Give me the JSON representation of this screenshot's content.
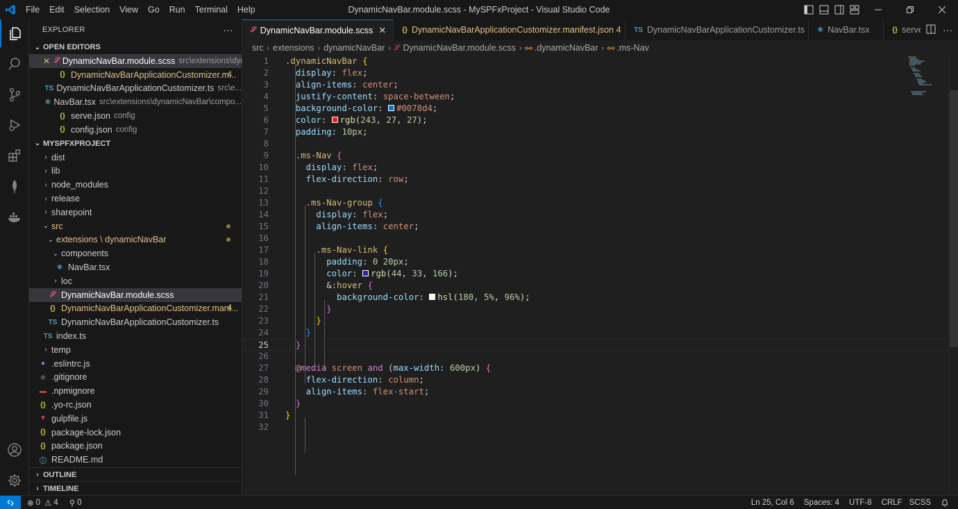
{
  "title_bar": {
    "menu": [
      "File",
      "Edit",
      "Selection",
      "View",
      "Go",
      "Run",
      "Terminal",
      "Help"
    ],
    "window_title": "DynamicNavBar.module.scss - MySPFxProject - Visual Studio Code"
  },
  "sidebar": {
    "header": "EXPLORER",
    "open_editors_label": "OPEN EDITORS",
    "open_editors": [
      {
        "name": "DynamicNavBar.module.scss",
        "desc": "src\\extensions\\dyn...",
        "icon": "scss-icon",
        "badge": ""
      },
      {
        "name": "DynamicNavBarApplicationCustomizer.m...",
        "desc": "",
        "icon": "json-icon",
        "badge": "4"
      },
      {
        "name": "DynamicNavBarApplicationCustomizer.ts",
        "desc": "src\\e...",
        "icon": "ts-icon",
        "badge": ""
      },
      {
        "name": "NavBar.tsx",
        "desc": "src\\extensions\\dynamicNavBar\\compo...",
        "icon": "react-icon",
        "badge": ""
      },
      {
        "name": "serve.json",
        "desc": "config",
        "icon": "json-icon",
        "badge": ""
      },
      {
        "name": "config.json",
        "desc": "config",
        "icon": "json-icon",
        "badge": ""
      }
    ],
    "project_label": "MYSPFXPROJECT",
    "tree": [
      {
        "name": "dist",
        "type": "folder"
      },
      {
        "name": "lib",
        "type": "folder"
      },
      {
        "name": "node_modules",
        "type": "folder"
      },
      {
        "name": "release",
        "type": "folder"
      },
      {
        "name": "sharepoint",
        "type": "folder"
      },
      {
        "name": "src",
        "type": "folder-open"
      },
      {
        "name": "extensions \\ dynamicNavBar",
        "type": "folder-open"
      },
      {
        "name": "components",
        "type": "folder-open"
      },
      {
        "name": "NavBar.tsx",
        "type": "file"
      },
      {
        "name": "loc",
        "type": "folder"
      },
      {
        "name": "DynamicNavBar.module.scss",
        "type": "file"
      },
      {
        "name": "DynamicNavBarApplicationCustomizer.mani...",
        "type": "file",
        "badge": "4"
      },
      {
        "name": "DynamicNavBarApplicationCustomizer.ts",
        "type": "file"
      },
      {
        "name": "index.ts",
        "type": "file"
      },
      {
        "name": "temp",
        "type": "folder"
      },
      {
        "name": ".eslintrc.js",
        "type": "file"
      },
      {
        "name": ".gitignore",
        "type": "file"
      },
      {
        "name": ".npmignore",
        "type": "file"
      },
      {
        "name": ".yo-rc.json",
        "type": "file"
      },
      {
        "name": "gulpfile.js",
        "type": "file"
      },
      {
        "name": "package-lock.json",
        "type": "file"
      },
      {
        "name": "package.json",
        "type": "file"
      },
      {
        "name": "README.md",
        "type": "file"
      }
    ],
    "outline_label": "OUTLINE",
    "timeline_label": "TIMELINE"
  },
  "tabs": [
    {
      "label": "DynamicNavBar.module.scss",
      "icon": "scss-icon",
      "active": true
    },
    {
      "label": "DynamicNavBarApplicationCustomizer.manifest.json 4",
      "icon": "json-icon",
      "active": false
    },
    {
      "label": "DynamicNavBarApplicationCustomizer.ts",
      "icon": "ts-icon",
      "active": false
    },
    {
      "label": "NavBar.tsx",
      "icon": "react-icon",
      "active": false
    },
    {
      "label": "serve.js",
      "icon": "json-icon",
      "active": false
    }
  ],
  "breadcrumbs": [
    "src",
    "extensions",
    "dynamicNavBar",
    "DynamicNavBar.module.scss",
    ".dynamicNavBar",
    ".ms-Nav"
  ],
  "code_lines": [
    ".dynamicNavBar {",
    "  display: flex;",
    "  align-items: center;",
    "  justify-content: space-between;",
    "  background-color: #0078d4;",
    "  color: rgb(243, 27, 27);",
    "  padding: 10px;",
    "",
    "  .ms-Nav {",
    "    display: flex;",
    "    flex-direction: row;",
    "",
    "    .ms-Nav-group {",
    "      display: flex;",
    "      align-items: center;",
    "",
    "      .ms-Nav-link {",
    "        padding: 0 20px;",
    "        color: rgb(44, 33, 166);",
    "        &:hover {",
    "          background-color: hsl(180, 5%, 96%);",
    "        }",
    "      }",
    "    }",
    "  }",
    "",
    "  @media screen and (max-width: 600px) {",
    "    flex-direction: column;",
    "    align-items: flex-start;",
    "  }",
    "}",
    ""
  ],
  "current_line": 25,
  "status": {
    "errors": "0",
    "warnings": "4",
    "ports": "0",
    "position": "Ln 25, Col 6",
    "spaces": "Spaces: 4",
    "encoding": "UTF-8",
    "eol": "CRLF",
    "language": "SCSS"
  },
  "colors": {
    "accent": "#0078d4",
    "selector": "#d7ba7d",
    "property": "#9cdcfe",
    "value": "#ce9178",
    "number": "#b5cea8"
  }
}
